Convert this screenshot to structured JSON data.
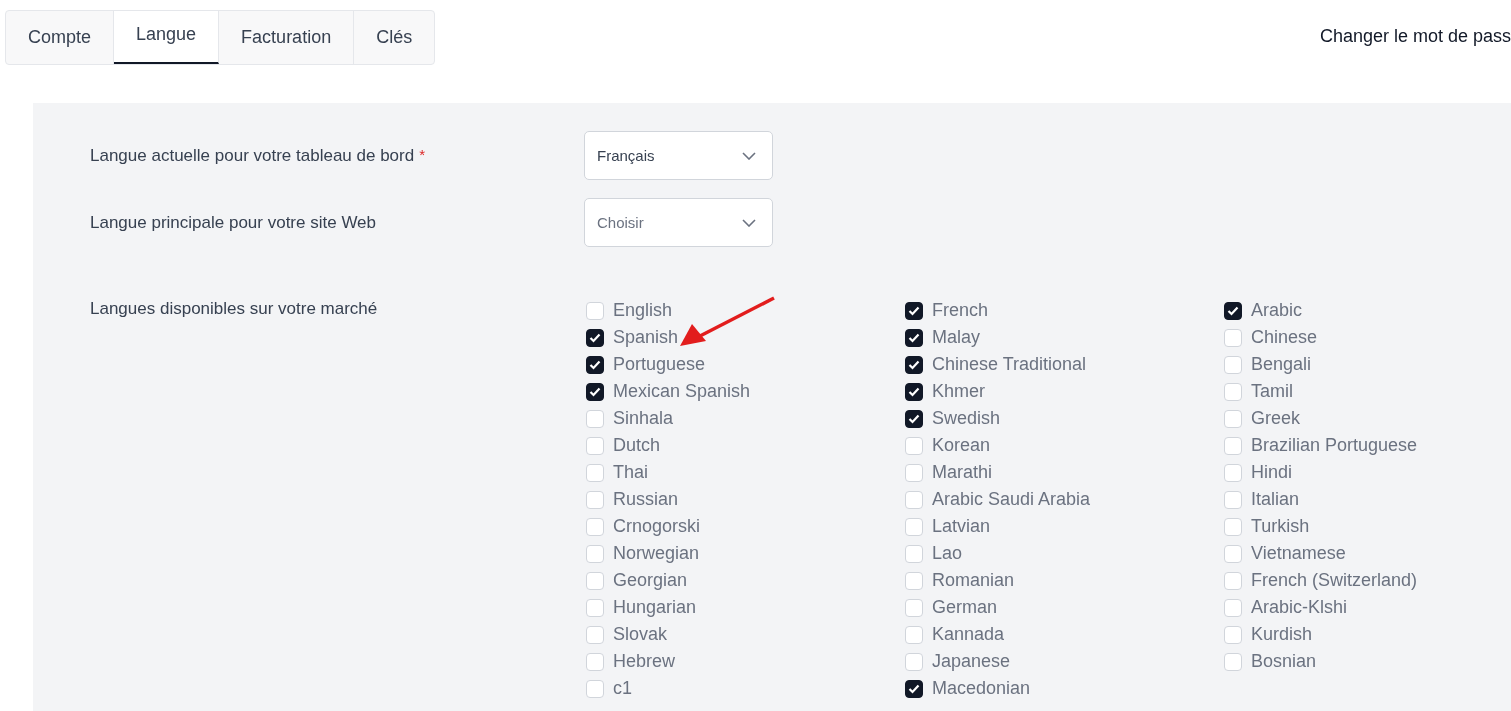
{
  "tabs": [
    {
      "label": "Compte",
      "selected": false
    },
    {
      "label": "Langue",
      "selected": true
    },
    {
      "label": "Facturation",
      "selected": false
    },
    {
      "label": "Clés",
      "selected": false
    }
  ],
  "password_link": "Changer le mot de pass",
  "fields": [
    {
      "label": "Langue actuelle pour votre tableau de bord",
      "required_mark": "*",
      "value": "Français"
    },
    {
      "label": "Langue principale pour votre site Web",
      "placeholder": "Choisir"
    }
  ],
  "languages": {
    "label": "Langues disponibles sur votre marché",
    "columns": [
      [
        {
          "name": "English",
          "checked": false
        },
        {
          "name": "Spanish",
          "checked": true
        },
        {
          "name": "Portuguese",
          "checked": true
        },
        {
          "name": "Mexican Spanish",
          "checked": true
        },
        {
          "name": "Sinhala",
          "checked": false
        },
        {
          "name": "Dutch",
          "checked": false
        },
        {
          "name": "Thai",
          "checked": false
        },
        {
          "name": "Russian",
          "checked": false
        },
        {
          "name": "Crnogorski",
          "checked": false
        },
        {
          "name": "Norwegian",
          "checked": false
        },
        {
          "name": "Georgian",
          "checked": false
        },
        {
          "name": "Hungarian",
          "checked": false
        },
        {
          "name": "Slovak",
          "checked": false
        },
        {
          "name": "Hebrew",
          "checked": false
        },
        {
          "name": "c1",
          "checked": false
        }
      ],
      [
        {
          "name": "French",
          "checked": true
        },
        {
          "name": "Malay",
          "checked": true
        },
        {
          "name": "Chinese Traditional",
          "checked": true
        },
        {
          "name": "Khmer",
          "checked": true
        },
        {
          "name": "Swedish",
          "checked": true
        },
        {
          "name": "Korean",
          "checked": false
        },
        {
          "name": "Marathi",
          "checked": false
        },
        {
          "name": "Arabic Saudi Arabia",
          "checked": false
        },
        {
          "name": "Latvian",
          "checked": false
        },
        {
          "name": "Lao",
          "checked": false
        },
        {
          "name": "Romanian",
          "checked": false
        },
        {
          "name": "German",
          "checked": false
        },
        {
          "name": "Kannada",
          "checked": false
        },
        {
          "name": "Japanese",
          "checked": false
        },
        {
          "name": "Macedonian",
          "checked": true
        }
      ],
      [
        {
          "name": "Arabic",
          "checked": true
        },
        {
          "name": "Chinese",
          "checked": false
        },
        {
          "name": "Bengali",
          "checked": false
        },
        {
          "name": "Tamil",
          "checked": false
        },
        {
          "name": "Greek",
          "checked": false
        },
        {
          "name": "Brazilian Portuguese",
          "checked": false
        },
        {
          "name": "Hindi",
          "checked": false
        },
        {
          "name": "Italian",
          "checked": false
        },
        {
          "name": "Turkish",
          "checked": false
        },
        {
          "name": "Vietnamese",
          "checked": false
        },
        {
          "name": "French (Switzerland)",
          "checked": false
        },
        {
          "name": "Arabic-Klshi",
          "checked": false
        },
        {
          "name": "Kurdish",
          "checked": false
        },
        {
          "name": "Bosnian",
          "checked": false
        }
      ]
    ]
  }
}
